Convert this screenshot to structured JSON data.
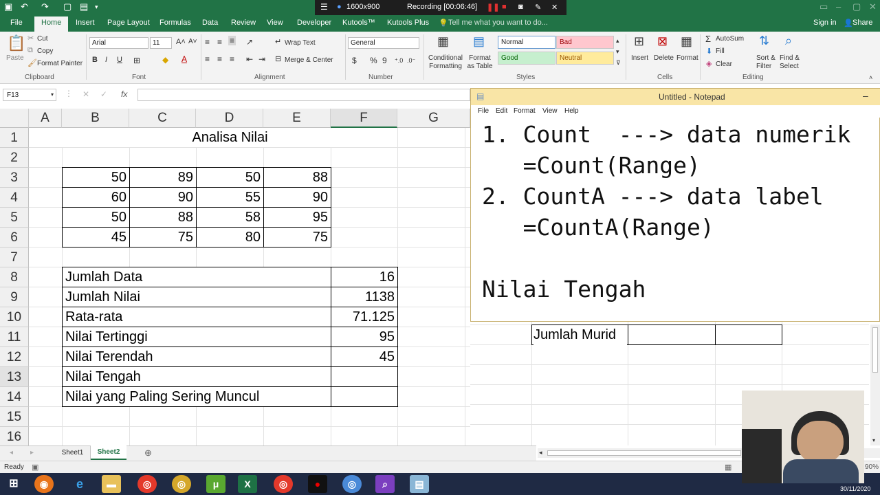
{
  "titlebar": {
    "resolution": "1600x900",
    "recording": "Recording [00:06:46]"
  },
  "ribbon_tabs": [
    "File",
    "Home",
    "Insert",
    "Page Layout",
    "Formulas",
    "Data",
    "Review",
    "View",
    "Developer",
    "Kutools™",
    "Kutools Plus"
  ],
  "tell_me": "Tell me what you want to do...",
  "signin": "Sign in",
  "share": "Share",
  "clipboard": {
    "paste": "Paste",
    "cut": "Cut",
    "copy": "Copy",
    "format_painter": "Format Painter",
    "label": "Clipboard"
  },
  "font": {
    "name": "Arial",
    "size": "11",
    "bold": "B",
    "italic": "I",
    "underline": "U",
    "label": "Font"
  },
  "alignment": {
    "wrap": "Wrap Text",
    "merge": "Merge & Center",
    "label": "Alignment"
  },
  "number": {
    "format": "General",
    "currency": "$",
    "percent": "%",
    "comma": "9",
    "label": "Number"
  },
  "styles": {
    "conditional": "Conditional Formatting",
    "format_table": "Format as Table",
    "normal": "Normal",
    "bad": "Bad",
    "good": "Good",
    "neutral": "Neutral",
    "label": "Styles",
    "colors": {
      "normal": "#ffffff",
      "bad": "#ffc7ce",
      "good": "#c6efce",
      "neutral": "#ffeb9c"
    }
  },
  "cells": {
    "insert": "Insert",
    "delete": "Delete",
    "format": "Format",
    "label": "Cells"
  },
  "editing": {
    "autosum": "AutoSum",
    "fill": "Fill",
    "clear": "Clear",
    "sort": "Sort & Filter",
    "find": "Find & Select",
    "label": "Editing"
  },
  "namebox": "F13",
  "fx": "fx",
  "columns": [
    "A",
    "B",
    "C",
    "D",
    "E",
    "F",
    "G"
  ],
  "rows": [
    "1",
    "2",
    "3",
    "4",
    "5",
    "6",
    "7",
    "8",
    "9",
    "10",
    "11",
    "12",
    "13",
    "14",
    "15",
    "16"
  ],
  "sheet": {
    "title": "Analisa Nilai",
    "table": [
      [
        "50",
        "89",
        "50",
        "88"
      ],
      [
        "60",
        "90",
        "55",
        "90"
      ],
      [
        "50",
        "88",
        "58",
        "95"
      ],
      [
        "45",
        "75",
        "80",
        "75"
      ]
    ],
    "summary": [
      {
        "label": "Jumlah Data",
        "value": "16"
      },
      {
        "label": "Jumlah Nilai",
        "value": "1138"
      },
      {
        "label": "Rata-rata",
        "value": "71.125"
      },
      {
        "label": "Nilai Tertinggi",
        "value": "95"
      },
      {
        "label": "Nilai Terendah",
        "value": "45"
      },
      {
        "label": "Nilai Tengah",
        "value": ""
      },
      {
        "label": "Nilai yang Paling Sering Muncul",
        "value": ""
      }
    ],
    "right_label": "Jumlah Murid"
  },
  "notepad": {
    "title": "Untitled - Notepad",
    "menu": [
      "File",
      "Edit",
      "Format",
      "View",
      "Help"
    ],
    "lines": [
      "1. Count  ---> data numerik",
      "   =Count(Range)",
      "2. CountA ---> data label",
      "   =CountA(Range)",
      "",
      "Nilai Tengah"
    ]
  },
  "sheet_tabs": [
    "Sheet1",
    "Sheet2"
  ],
  "status": {
    "ready": "Ready",
    "zoom": "90%"
  },
  "taskbar": {
    "date": "30/11/2020"
  }
}
